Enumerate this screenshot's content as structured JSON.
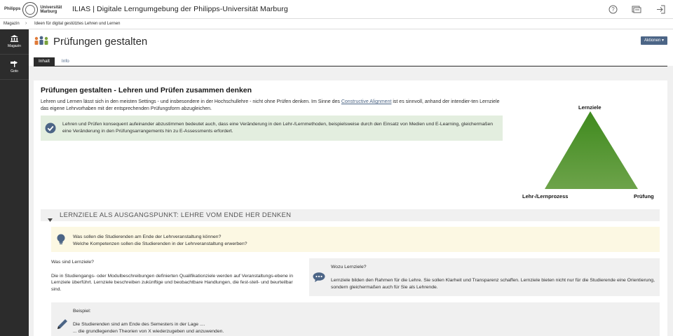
{
  "header": {
    "logo_left": "Philipps",
    "logo_right_1": "Universität",
    "logo_right_2": "Marburg",
    "title": "ILIAS | Digitale Lerngumgebung der Philipps-Universität Marburg",
    "icons": [
      "help-icon",
      "notifications-icon",
      "logout-icon"
    ]
  },
  "breadcrumb": {
    "items": [
      "Magazin",
      "Ideen für digital gestütztes Lehren und Lernen"
    ]
  },
  "rail": {
    "items": [
      {
        "label": "Magazin",
        "icon": "library-icon"
      },
      {
        "label": "Goto",
        "icon": "signpost-icon"
      }
    ]
  },
  "page": {
    "title": "Prüfungen gestalten",
    "actions_label": "Aktionen ▾",
    "tabs": [
      "Inhalt",
      "Info"
    ],
    "active_tab": "Inhalt"
  },
  "content": {
    "heading": "Prüfungen gestalten - Lehren und Prüfen zusammen denken",
    "intro_1": "Lehren und Lernen lässt sich in den meisten Settings - und insbesondere in der Hochschullehre - nicht ohne Prüfen denken.  Im Sinne des ",
    "intro_link": "Constructive Alignment",
    "intro_2": " ist es sinnvoll, anhand der intendier-ten Lernziele das eigene Lehrvorhaben mit der entsprechenden Prüfungsform abzugleichen.",
    "notice": "Lehren und Prüfen konsequent aufeinander abzustimmen bedeutet auch, dass eine Veränderung in den Lehr-/Lernmethoden, beispielsweise durch den Einsatz von Medien und E-Learning, gleichermaßen eine Veränderung in den Prüfungsarrangements hin zu E-Assessments erfordert.",
    "triangle": {
      "top": "Lernziele",
      "left": "Lehr-/Lernprozess",
      "right": "Prüfung",
      "color": "#4a8a28"
    },
    "accordion_title": "LERNZIELE ALS AUSGANGSPUNKT: LEHRE VOM ENDE HER DENKEN",
    "hint_1": "Was sollen die Studierenden am Ende der Lehrveranstaltung können?",
    "hint_2": "Welche Kompetenzen sollen die Studierenden in der Lehrveranstaltung erwerben?",
    "left_question": "Was sind Lernziele?",
    "left_text": "Die in Studiengangs- oder Modulbeschreibungen definierten Qualifikationziele werden auf Veranstaltungs-ebene in Lernziele überführt. Lernziele beschreiben zukünftige und beobachtbare Handlungen, die fest-stell- und beurteilbar sind.",
    "right_question": "Wozu Lernziele?",
    "right_text": "Lernziele bilden den Rahmen für die Lehre. Sie sollen Klarheit und Transparenz schaffen. Lernziele bieten nicht nur für die Studierende eine Orientierung, sondern gleichermaßen auch für Sie als Lehrende.",
    "example_label": "Beispiel:",
    "example_1": "Die Studierenden sind am Ende des Semesters in der Lage ....",
    "example_2": "... die grundlegenden Theorien von X wiederzugeben und anzuwenden."
  },
  "colors": {
    "rail": "#2c2c2c",
    "accent": "#4c6586",
    "notice_bg": "#e3eedf",
    "hint_bg": "#fcf8e3"
  }
}
